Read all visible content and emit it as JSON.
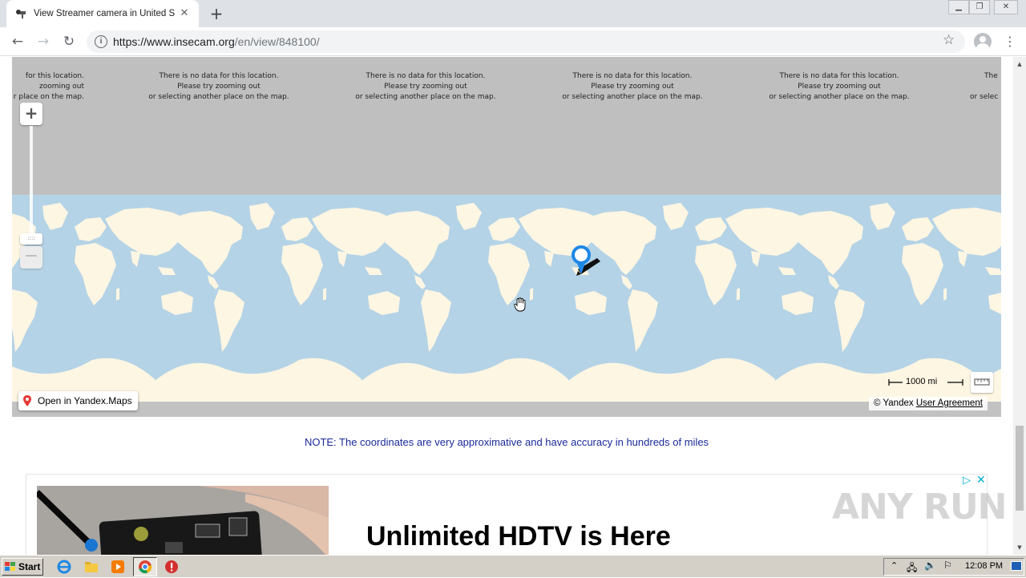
{
  "browser": {
    "tab_title": "View Streamer camera in United States",
    "url_host": "https://www.insecam.org",
    "url_path": "/en/view/848100/"
  },
  "map": {
    "no_data_line1": "There is no data for this location.",
    "no_data_line2": "Please try zooming out",
    "no_data_line3": "or selecting another place on the map.",
    "partial_left_line1": "for this location.",
    "partial_left_line2": "zooming out",
    "partial_left_line3": "r place on the map.",
    "partial_right_line1": "The",
    "partial_right_line2": "",
    "partial_right_line3": "or selec",
    "zoom_in": "+",
    "zoom_out": "−",
    "zoom_handle": "::::",
    "open_in_yandex": "Open in Yandex.Maps",
    "scale_label": "1000 mi",
    "copyright": "© Yandex",
    "user_agreement": "User Agreement",
    "ocean_color": "#b5d3e6",
    "land_color": "#fdf6e3",
    "marker_color": "#1e88e5"
  },
  "page": {
    "note": "NOTE: The coordinates are very approximative and have accuracy in hundreds of miles"
  },
  "ad": {
    "headline": "Unlimited HDTV is Here",
    "choices_icon": "play-triangle-icon",
    "close_icon": "close-icon"
  },
  "watermark": "ANY RUN",
  "taskbar": {
    "start_label": "Start",
    "clock": "12:08 PM"
  }
}
